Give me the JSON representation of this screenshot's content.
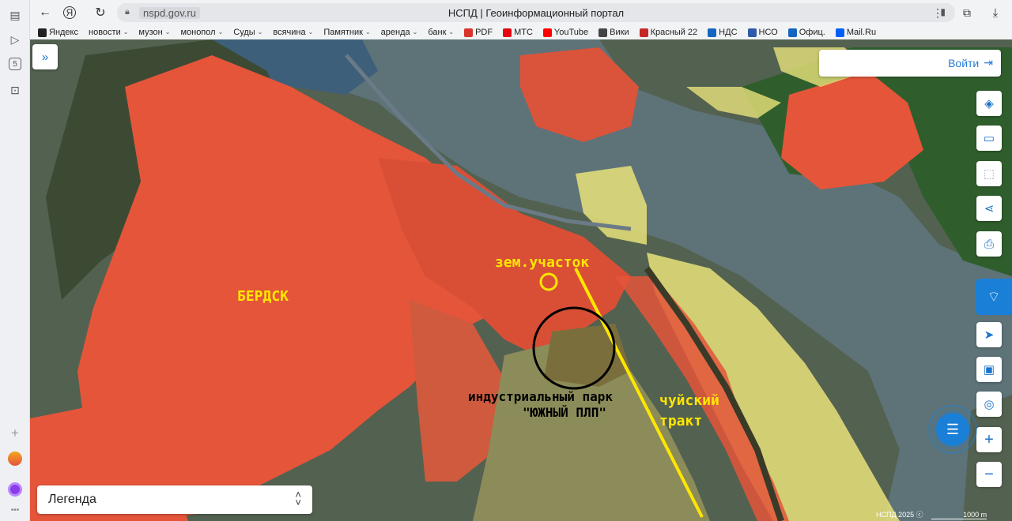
{
  "browser": {
    "url": "nspd.gov.ru",
    "title": "НСПД | Геоинформационный портал"
  },
  "bookmarks": [
    {
      "label": "Яндекс",
      "icon": "yandex-icon",
      "color": "#222",
      "menu": false
    },
    {
      "label": "новости",
      "icon": "",
      "color": "",
      "menu": true
    },
    {
      "label": "музон",
      "icon": "",
      "color": "",
      "menu": true
    },
    {
      "label": "монопол",
      "icon": "",
      "color": "",
      "menu": true
    },
    {
      "label": "Суды",
      "icon": "",
      "color": "",
      "menu": true
    },
    {
      "label": "всячина",
      "icon": "",
      "color": "",
      "menu": true
    },
    {
      "label": "Памятник",
      "icon": "",
      "color": "",
      "menu": true
    },
    {
      "label": "аренда",
      "icon": "",
      "color": "",
      "menu": true
    },
    {
      "label": "банк",
      "icon": "",
      "color": "",
      "menu": true
    },
    {
      "label": "PDF",
      "icon": "pdf-icon",
      "color": "#d9342b",
      "menu": false
    },
    {
      "label": "МТС",
      "icon": "mts-icon",
      "color": "#e30611",
      "menu": false
    },
    {
      "label": "YouTube",
      "icon": "youtube-icon",
      "color": "#ff0000",
      "menu": false
    },
    {
      "label": "Вики",
      "icon": "wiki-icon",
      "color": "#444",
      "menu": false
    },
    {
      "label": "Красный 22",
      "icon": "badge-icon",
      "color": "#c62828",
      "menu": false
    },
    {
      "label": "НДС",
      "icon": "nds-icon",
      "color": "#1565c0",
      "menu": false
    },
    {
      "label": "НСО",
      "icon": "nso-icon",
      "color": "#2e5aa8",
      "menu": false
    },
    {
      "label": "Офиц.",
      "icon": "flag-icon",
      "color": "#1565c0",
      "menu": false
    },
    {
      "label": "Mail.Ru",
      "icon": "mail-icon",
      "color": "#005ff9",
      "menu": false
    }
  ],
  "map": {
    "login_label": "Войти",
    "legend_label": "Легенда",
    "copyright": "НСПД 2025",
    "scale_label": "1000 m",
    "labels": {
      "city": "БЕРДСК",
      "plot": "зем.участок",
      "park_line1": "индустриальный парк",
      "park_line2": "\"ЮЖНЫЙ ПЛП\"",
      "road_line1": "чуйский",
      "road_line2": "тракт"
    },
    "colors": {
      "parcels": "#e4553a",
      "zones": "#e8e27a",
      "water": "#5d7378",
      "annotation": "#ffe600"
    }
  }
}
